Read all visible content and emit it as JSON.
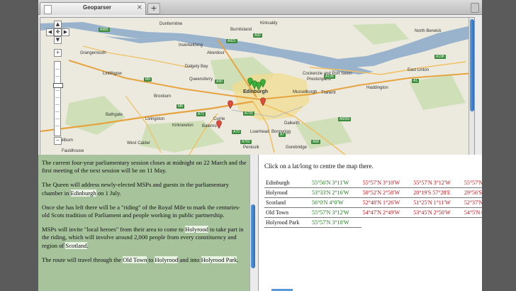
{
  "tab": {
    "title": "Geoparser",
    "close_glyph": "×",
    "new_tab_glyph": "+"
  },
  "map": {
    "controls": {
      "up": "▲",
      "left": "◀",
      "center": "✥",
      "right": "▶",
      "down": "▼",
      "zoom_in": "+",
      "zoom_out": "−"
    },
    "places": [
      "Dunfermline",
      "Burntisland",
      "Kirkcaldy",
      "North Berwick",
      "Grangemouth",
      "Inverkeithing",
      "Aberdour",
      "Linlithgow",
      "Dalgety Bay",
      "Queensferry",
      "Cockenzie and Port Seton",
      "Prestonpans",
      "Tranent",
      "East Linton",
      "Haddington",
      "Broxburn",
      "Musselburgh",
      "Livingston",
      "Bathgate",
      "Kirknewton",
      "Currie",
      "Balerno",
      "Dalkeith",
      "Bonnyrigg",
      "Loanhead",
      "Penicuik",
      "Gorebridge",
      "Whitburn",
      "West Calder",
      "Edinburgh",
      "Fauldhouse"
    ],
    "roads": [
      "A985",
      "A921",
      "A92",
      "A198",
      "A1",
      "M9",
      "A90",
      "M8",
      "A71",
      "A70",
      "A720",
      "A7",
      "A68",
      "A6093",
      "A199",
      "A702"
    ]
  },
  "article": {
    "paragraphs": [
      [
        {
          "t": "The current four-year parliamentary session closes at midnight on 22 March and the first meeting of the next session will be on 11 May."
        }
      ],
      [
        {
          "t": "The Queen will address newly-elected MSPs and guests in the parliamentary chamber in "
        },
        {
          "t": "Edinburgh",
          "hl": true
        },
        {
          "t": " on 1 July."
        }
      ],
      [
        {
          "t": "Once she has left there will be a \"riding\" of the Royal Mile to mark the centuries-old Scots tradition of Parliament and people working in public partnership."
        }
      ],
      [
        {
          "t": "MSPs will invite \"local heroes\" from their area to come to "
        },
        {
          "t": "Holyrood",
          "hl": true
        },
        {
          "t": " to take part in the riding, which will involve around 2,000 people from every constituency and region of "
        },
        {
          "t": "Scotland",
          "hl": true
        },
        {
          "t": "."
        }
      ],
      [
        {
          "t": "The route will travel through the "
        },
        {
          "t": "Old Town",
          "hl": true
        },
        {
          "t": " to "
        },
        {
          "t": "Holyrood",
          "hl": true
        },
        {
          "t": " and into "
        },
        {
          "t": "Holyrood Park",
          "hl": true
        },
        {
          "t": "."
        }
      ]
    ]
  },
  "right": {
    "hint": "Click on a lat/long to centre the map there.",
    "rows": [
      {
        "name": "Edinburgh",
        "coords": [
          {
            "v": "55°56'N 3°11'W",
            "c": "g"
          },
          {
            "v": "55°57'N 3°10'W",
            "c": "r"
          },
          {
            "v": "55°57'N 3°12'W",
            "c": "r"
          },
          {
            "v": "55°57'N 3°",
            "c": "r"
          }
        ]
      },
      {
        "name": "Holyrood",
        "coords": [
          {
            "v": "53°33'N 2°16'W",
            "c": "g"
          },
          {
            "v": "50°52'N 2°58'W",
            "c": "r"
          },
          {
            "v": "20°19'S 57°28'E",
            "c": "r"
          },
          {
            "v": "29°56'S 29",
            "c": "r"
          }
        ]
      },
      {
        "name": "Scotland",
        "coords": [
          {
            "v": "56°0'N 4°0'W",
            "c": "g"
          },
          {
            "v": "52°48'N 1°26'W",
            "c": "r"
          },
          {
            "v": "51°25'N 1°11'W",
            "c": "r"
          },
          {
            "v": "52°37'N 2°",
            "c": "r"
          }
        ]
      },
      {
        "name": "Old Town",
        "coords": [
          {
            "v": "55°57'N 3°12'W",
            "c": "g"
          },
          {
            "v": "54°47'N 2°49'W",
            "c": "r"
          },
          {
            "v": "53°45'N 2°50'W",
            "c": "r"
          },
          {
            "v": "54°5'N 0°1",
            "c": "r"
          }
        ]
      },
      {
        "name": "Holyrood Park",
        "coords": [
          {
            "v": "55°57'N 3°10'W",
            "c": "g"
          }
        ]
      }
    ]
  }
}
